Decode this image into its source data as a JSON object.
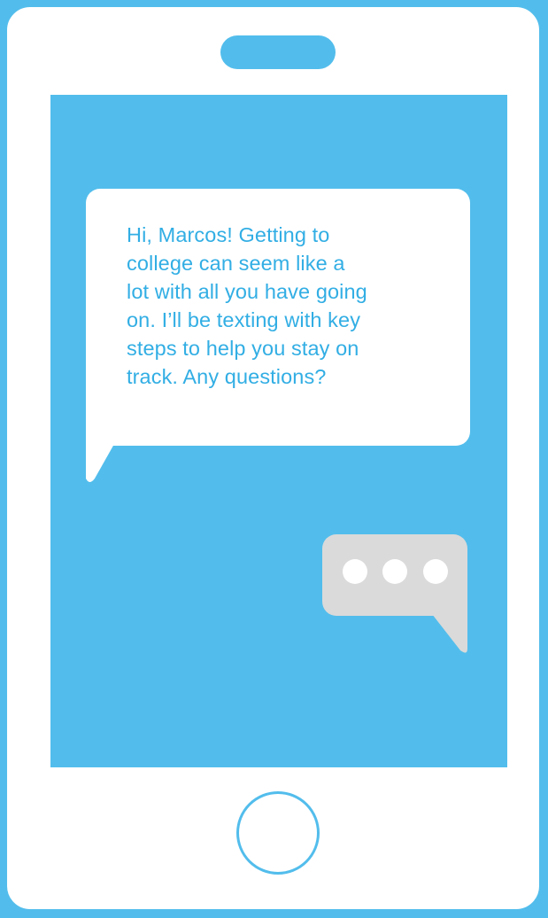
{
  "colors": {
    "accent": "#52bdec",
    "message_text": "#32aee4",
    "bubble": "#ffffff",
    "typing_bubble": "#dadada"
  },
  "message": {
    "text": "Hi, Marcos! Getting to\ncollege can seem like a\nlot with all you have going\non. I’ll be texting with key\nsteps to help you stay on\ntrack. Any questions?"
  },
  "typing_indicator": {
    "dots": 3,
    "icon": "typing-ellipsis-icon"
  },
  "icons": {
    "speaker": "speaker-icon",
    "home_button": "home-button-icon"
  }
}
